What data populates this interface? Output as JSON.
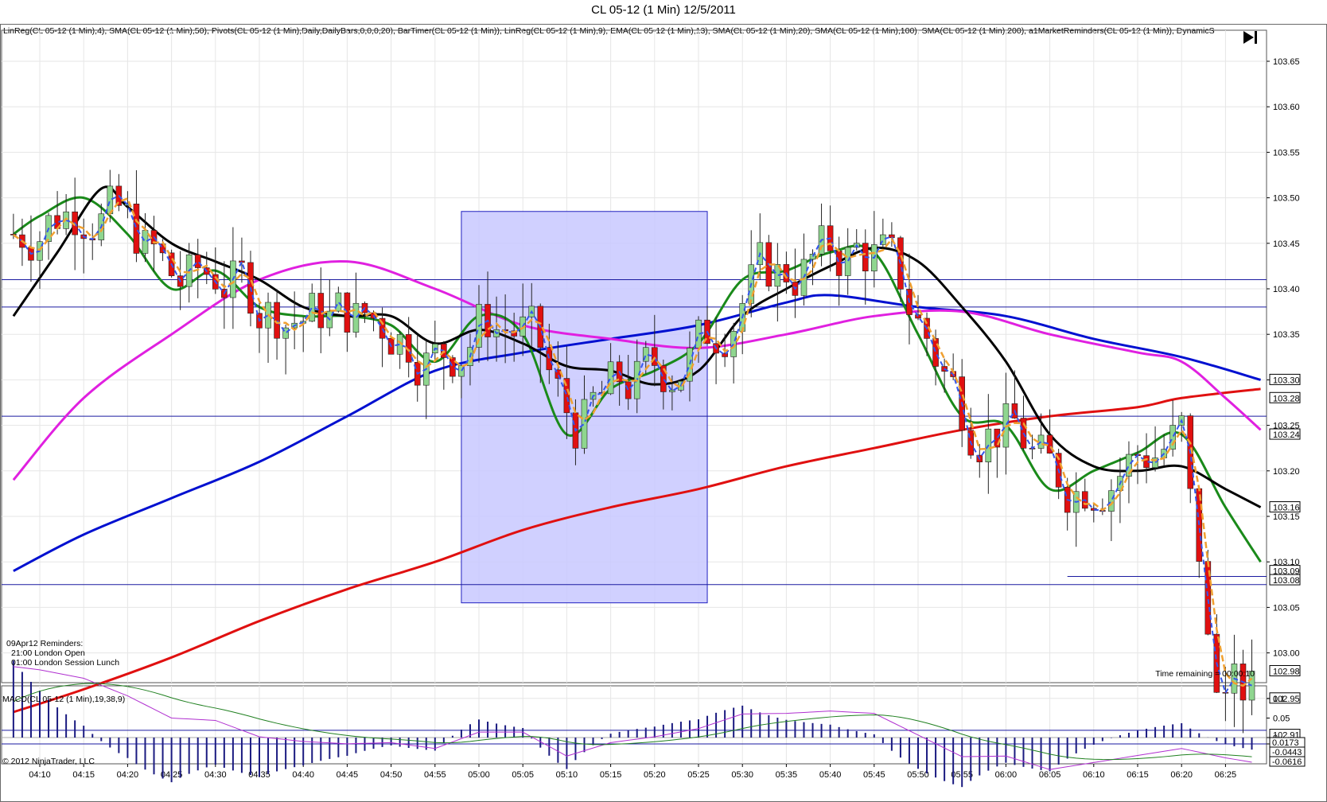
{
  "title": "CL 05-12 (1 Min)  12/5/2011",
  "indicators_line": "LinReg(CL 05-12 (1 Min),4), SMA(CL 05-12 (1 Min),50), Pivots(CL 05-12 (1 Min),Daily,DailyBars,0,0,0,20), BarTimer(CL 05-12 (1 Min)), LinReg(CL 05-12 (1 Min),9), EMA(CL 05-12 (1 Min),13), SMA(CL 05-12 (1 Min),20), SMA(CL 05-12 (1 Min),100), SMA(CL 05-12 (1 Min),200), a1MarketReminders(CL 05-12 (1 Min)), DynamicS",
  "reminders": {
    "heading": "09Apr12 Reminders:",
    "items": [
      "21:00 London Open",
      "01:00 London Session Lunch"
    ]
  },
  "time_remaining": "Time remaining = 00:00:10",
  "macd_label": "MACD(CL 05-12 (1 Min),19,38,9)",
  "copyright": "© 2012 NinjaTrader, LLC",
  "colors": {
    "up_candle": "#8fd68f",
    "down_candle": "#e01010",
    "linreg4": "#f0a030",
    "linreg9": "#3355ee",
    "ema13": "#1a8a1a",
    "sma20": "#000000",
    "sma50": "#e020e0",
    "sma100": "#0010d0",
    "sma200": "#e01010",
    "pivot_lines": "#1a1aa0",
    "highlight": "#c8c8ff",
    "macd": "#b030d0",
    "macd_signal": "#208020",
    "macd_hist": "#1a1a80"
  },
  "chart_data": [
    {
      "type": "candlestick",
      "name": "price",
      "x_tick_labels": [
        "04:10",
        "04:15",
        "04:20",
        "04:25",
        "04:30",
        "04:35",
        "04:40",
        "04:45",
        "04:50",
        "04:55",
        "05:00",
        "05:05",
        "05:10",
        "05:15",
        "05:20",
        "05:25",
        "05:30",
        "05:35",
        "05:40",
        "05:45",
        "05:50",
        "05:55",
        "06:00",
        "06:05",
        "06:10",
        "06:15",
        "06:20",
        "06:25"
      ],
      "y_tick_labels": [
        "103.65",
        "103.60",
        "103.55",
        "103.50",
        "103.45",
        "103.40",
        "103.35",
        "103.30",
        "103.25",
        "103.20",
        "103.15",
        "103.10",
        "103.05",
        "103.00",
        "102.95",
        "102.90"
      ],
      "ylim": [
        102.885,
        103.675
      ],
      "price_marker_labels": [
        "103.30",
        "103.28",
        "103.24",
        "103.16",
        "103.09",
        "103.08",
        "102.98",
        "102.95",
        "102.91"
      ],
      "price_marker_values": [
        103.3,
        103.28,
        103.24,
        103.16,
        103.09,
        103.08,
        102.98,
        102.95,
        102.91
      ],
      "horizontal_levels": [
        103.41,
        103.38,
        103.26,
        103.075,
        102.915,
        102.9
      ],
      "highlight_box": {
        "x_start": "04:58",
        "x_end": "05:26",
        "y_low": 103.055,
        "y_high": 103.485
      },
      "sma20_path": [
        [
          "04:07",
          103.37
        ],
        [
          "04:12",
          103.44
        ],
        [
          "04:17",
          103.51
        ],
        [
          "04:20",
          103.49
        ],
        [
          "04:25",
          103.45
        ],
        [
          "04:30",
          103.43
        ],
        [
          "04:35",
          103.41
        ],
        [
          "04:40",
          103.38
        ],
        [
          "04:45",
          103.37
        ],
        [
          "04:50",
          103.37
        ],
        [
          "04:55",
          103.34
        ],
        [
          "05:00",
          103.355
        ],
        [
          "05:05",
          103.34
        ],
        [
          "05:10",
          103.315
        ],
        [
          "05:15",
          103.31
        ],
        [
          "05:20",
          103.295
        ],
        [
          "05:25",
          103.31
        ],
        [
          "05:30",
          103.37
        ],
        [
          "05:35",
          103.4
        ],
        [
          "05:40",
          103.425
        ],
        [
          "05:45",
          103.445
        ],
        [
          "05:50",
          103.43
        ],
        [
          "05:55",
          103.38
        ],
        [
          "06:00",
          103.32
        ],
        [
          "06:05",
          103.24
        ],
        [
          "06:10",
          103.205
        ],
        [
          "06:15",
          103.2
        ],
        [
          "06:20",
          103.205
        ],
        [
          "06:25",
          103.18
        ],
        [
          "06:29",
          103.16
        ]
      ],
      "ema13_path": [
        [
          "04:07",
          103.46
        ],
        [
          "04:10",
          103.48
        ],
        [
          "04:15",
          103.5
        ],
        [
          "04:20",
          103.46
        ],
        [
          "04:25",
          103.4
        ],
        [
          "04:30",
          103.42
        ],
        [
          "04:35",
          103.38
        ],
        [
          "04:40",
          103.37
        ],
        [
          "04:45",
          103.37
        ],
        [
          "04:50",
          103.36
        ],
        [
          "04:55",
          103.32
        ],
        [
          "05:00",
          103.37
        ],
        [
          "05:05",
          103.35
        ],
        [
          "05:10",
          103.24
        ],
        [
          "05:15",
          103.29
        ],
        [
          "05:20",
          103.31
        ],
        [
          "05:25",
          103.34
        ],
        [
          "05:30",
          103.41
        ],
        [
          "05:35",
          103.42
        ],
        [
          "05:40",
          103.44
        ],
        [
          "05:45",
          103.44
        ],
        [
          "05:50",
          103.35
        ],
        [
          "05:55",
          103.26
        ],
        [
          "06:00",
          103.25
        ],
        [
          "06:05",
          103.18
        ],
        [
          "06:10",
          103.2
        ],
        [
          "06:15",
          103.22
        ],
        [
          "06:20",
          103.24
        ],
        [
          "06:25",
          103.16
        ],
        [
          "06:29",
          103.1
        ]
      ],
      "sma50_path": [
        [
          "04:07",
          103.19
        ],
        [
          "04:15",
          103.28
        ],
        [
          "04:25",
          103.35
        ],
        [
          "04:35",
          103.41
        ],
        [
          "04:45",
          103.43
        ],
        [
          "04:55",
          103.4
        ],
        [
          "05:05",
          103.36
        ],
        [
          "05:15",
          103.345
        ],
        [
          "05:25",
          103.335
        ],
        [
          "05:35",
          103.35
        ],
        [
          "05:45",
          103.37
        ],
        [
          "05:55",
          103.375
        ],
        [
          "06:05",
          103.35
        ],
        [
          "06:15",
          103.33
        ],
        [
          "06:20",
          103.32
        ],
        [
          "06:25",
          103.28
        ],
        [
          "06:29",
          103.245
        ]
      ],
      "sma100_path": [
        [
          "04:07",
          103.09
        ],
        [
          "04:15",
          103.13
        ],
        [
          "04:25",
          103.17
        ],
        [
          "04:35",
          103.21
        ],
        [
          "04:45",
          103.26
        ],
        [
          "04:55",
          103.31
        ],
        [
          "05:05",
          103.33
        ],
        [
          "05:15",
          103.345
        ],
        [
          "05:25",
          103.36
        ],
        [
          "05:35",
          103.385
        ],
        [
          "05:40",
          103.393
        ],
        [
          "05:50",
          103.38
        ],
        [
          "06:00",
          103.37
        ],
        [
          "06:10",
          103.345
        ],
        [
          "06:20",
          103.325
        ],
        [
          "06:29",
          103.3
        ]
      ],
      "sma200_path": [
        [
          "04:07",
          102.935
        ],
        [
          "04:15",
          102.96
        ],
        [
          "04:25",
          102.995
        ],
        [
          "04:35",
          103.035
        ],
        [
          "04:45",
          103.07
        ],
        [
          "04:55",
          103.1
        ],
        [
          "05:05",
          103.135
        ],
        [
          "05:15",
          103.16
        ],
        [
          "05:25",
          103.18
        ],
        [
          "05:35",
          103.205
        ],
        [
          "05:45",
          103.225
        ],
        [
          "05:55",
          103.245
        ],
        [
          "06:05",
          103.26
        ],
        [
          "06:15",
          103.27
        ],
        [
          "06:20",
          103.28
        ],
        [
          "06:29",
          103.29
        ]
      ]
    },
    {
      "type": "line",
      "name": "MACD(CL 05-12 (1 Min),19,38,9)",
      "y_tick_labels": [
        "0.1",
        "0.05",
        "0"
      ],
      "price_marker_labels": [
        "0.0173",
        "-0.0443",
        "-0.0616"
      ],
      "price_marker_values": [
        0.0173,
        -0.0443,
        -0.0616
      ]
    }
  ]
}
